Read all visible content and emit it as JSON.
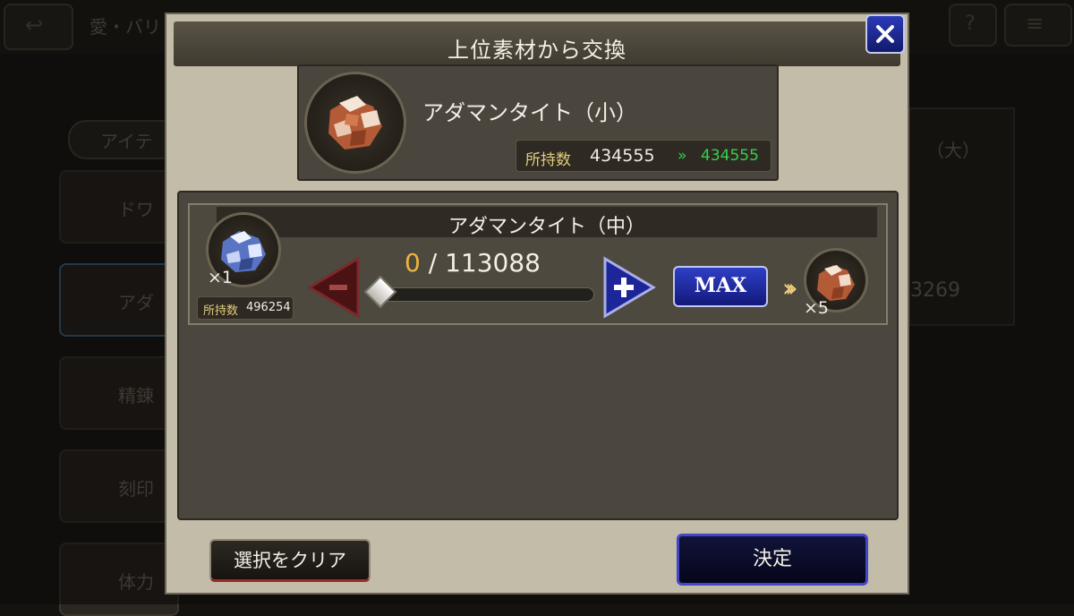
{
  "dialog": {
    "title": "上位素材から交換"
  },
  "target": {
    "name": "アダマンタイト（小）",
    "owned_label": "所持数",
    "owned_value": "434555",
    "owned_after": "434555"
  },
  "exchange": {
    "name": "アダマンタイト（中）",
    "source_qty": "×1",
    "owned_label": "所持数",
    "owned_value": "496254",
    "selected": "0",
    "separator": "/",
    "max_count": "113088",
    "max_label": "MAX",
    "yield_qty": "×5",
    "slider_fraction": 0
  },
  "footer": {
    "clear_label": "選択をクリア",
    "confirm_label": "決定"
  },
  "background": {
    "top_tab_text": "愛・バリ",
    "category_text": "アイテ",
    "side_items": [
      "ドワ",
      "アダ",
      "精錬",
      "刻印",
      "体力"
    ],
    "right_header": "（大）",
    "right_value": "3269"
  },
  "colors": {
    "accent_blue": "#2b3bb8",
    "counter_gold": "#f0b43a",
    "increase_green": "#35d04a"
  }
}
